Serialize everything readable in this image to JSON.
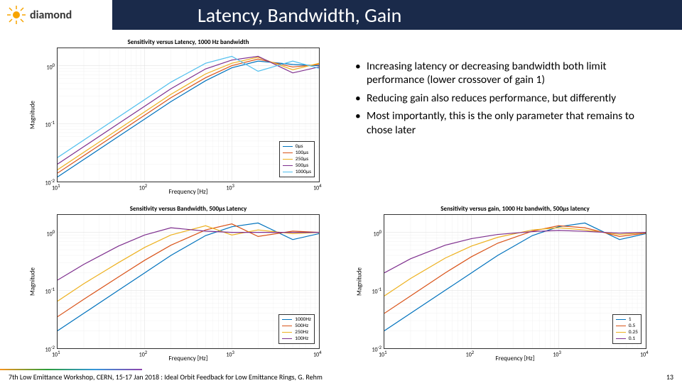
{
  "header": {
    "brand": "diamond",
    "title": "Latency, Bandwidth, Gain"
  },
  "bullets": [
    "Increasing latency or decreasing bandwidth both limit performance (lower crossover of gain 1)",
    "Reducing gain also reduces performance, but differently",
    "Most importantly, this is the only parameter that remains to chose later"
  ],
  "footer": {
    "text": "7th Low Emittance Workshop, CERN, 15-17 Jan 2018 : Ideal Orbit Feedback for Low Emittance Rings, G. Rehm",
    "page": "13"
  },
  "colors": {
    "c1": "#0072BD",
    "c2": "#D95319",
    "c3": "#EDB120",
    "c4": "#7E2F8E",
    "c5": "#4DBEEE"
  },
  "chart_data": [
    {
      "id": "chart-latency",
      "title": "Sensitivity versus Latency, 1000 Hz bandwidth",
      "type": "line",
      "x_scale": "log",
      "y_scale": "log",
      "xlabel": "Frequency [Hz]",
      "ylabel": "Magnitude",
      "xlim": [
        10,
        10000
      ],
      "ylim": [
        0.01,
        2
      ],
      "xticks": [
        10,
        100,
        1000,
        10000
      ],
      "yticks": [
        0.01,
        0.1,
        1
      ],
      "legend_pos": "bottom-right",
      "series": [
        {
          "name": "0µs",
          "color": "c1",
          "x": [
            10,
            20,
            50,
            100,
            200,
            500,
            1000,
            2000,
            5000,
            10000
          ],
          "y": [
            0.012,
            0.024,
            0.06,
            0.12,
            0.24,
            0.55,
            0.92,
            1.2,
            1.05,
            1.0
          ]
        },
        {
          "name": "100µs",
          "color": "c2",
          "x": [
            10,
            20,
            50,
            100,
            200,
            500,
            1000,
            2000,
            5000,
            10000
          ],
          "y": [
            0.014,
            0.028,
            0.07,
            0.14,
            0.28,
            0.62,
            1.0,
            1.3,
            0.95,
            1.05
          ]
        },
        {
          "name": "250µs",
          "color": "c3",
          "x": [
            10,
            20,
            50,
            100,
            200,
            500,
            1000,
            2000,
            5000,
            10000
          ],
          "y": [
            0.016,
            0.032,
            0.08,
            0.16,
            0.32,
            0.72,
            1.1,
            1.4,
            0.85,
            1.1
          ]
        },
        {
          "name": "500µs",
          "color": "c4",
          "x": [
            10,
            20,
            50,
            100,
            200,
            500,
            1000,
            2000,
            5000,
            10000
          ],
          "y": [
            0.02,
            0.04,
            0.1,
            0.2,
            0.4,
            0.88,
            1.25,
            1.45,
            0.75,
            0.95
          ]
        },
        {
          "name": "1000µs",
          "color": "c5",
          "x": [
            10,
            20,
            50,
            100,
            200,
            500,
            1000,
            2000,
            5000,
            10000
          ],
          "y": [
            0.026,
            0.052,
            0.13,
            0.26,
            0.52,
            1.1,
            1.45,
            0.8,
            1.2,
            0.9
          ]
        }
      ]
    },
    {
      "id": "chart-bandwidth",
      "title": "Sensitivity versus Bandwidth, 500µs Latency",
      "type": "line",
      "x_scale": "log",
      "y_scale": "log",
      "xlabel": "Frequency [Hz]",
      "ylabel": "Magnitude",
      "xlim": [
        10,
        10000
      ],
      "ylim": [
        0.01,
        2
      ],
      "xticks": [
        10,
        100,
        1000,
        10000
      ],
      "yticks": [
        0.01,
        0.1,
        1
      ],
      "legend_pos": "bottom-right",
      "series": [
        {
          "name": "1000Hz",
          "color": "c1",
          "x": [
            10,
            20,
            50,
            100,
            200,
            500,
            1000,
            2000,
            5000,
            10000
          ],
          "y": [
            0.02,
            0.04,
            0.1,
            0.2,
            0.4,
            0.88,
            1.25,
            1.45,
            0.75,
            0.95
          ]
        },
        {
          "name": "500Hz",
          "color": "c2",
          "x": [
            10,
            20,
            50,
            100,
            200,
            500,
            1000,
            2000,
            5000,
            10000
          ],
          "y": [
            0.035,
            0.07,
            0.17,
            0.33,
            0.6,
            1.1,
            1.4,
            0.85,
            1.05,
            1.0
          ]
        },
        {
          "name": "250Hz",
          "color": "c3",
          "x": [
            10,
            20,
            50,
            100,
            200,
            500,
            1000,
            2000,
            5000,
            10000
          ],
          "y": [
            0.065,
            0.13,
            0.3,
            0.55,
            0.9,
            1.3,
            0.9,
            1.1,
            0.95,
            1.0
          ]
        },
        {
          "name": "100Hz",
          "color": "c4",
          "x": [
            10,
            20,
            50,
            100,
            200,
            500,
            1000,
            2000,
            5000,
            10000
          ],
          "y": [
            0.15,
            0.28,
            0.58,
            0.9,
            1.2,
            1.05,
            1.0,
            1.0,
            1.0,
            1.0
          ]
        }
      ]
    },
    {
      "id": "chart-gain",
      "title": "Sensitivity versus gain, 1000 Hz bandwith, 500µs latency",
      "type": "line",
      "x_scale": "log",
      "y_scale": "log",
      "xlabel": "Frequency [Hz]",
      "ylabel": "Magnitude",
      "xlim": [
        10,
        10000
      ],
      "ylim": [
        0.01,
        2
      ],
      "xticks": [
        10,
        100,
        1000,
        10000
      ],
      "yticks": [
        0.01,
        0.1,
        1
      ],
      "legend_pos": "bottom-right",
      "series": [
        {
          "name": "1",
          "color": "c1",
          "x": [
            10,
            20,
            50,
            100,
            200,
            500,
            1000,
            2000,
            5000,
            10000
          ],
          "y": [
            0.02,
            0.04,
            0.1,
            0.2,
            0.4,
            0.88,
            1.25,
            1.45,
            0.75,
            0.95
          ]
        },
        {
          "name": "0.5",
          "color": "c2",
          "x": [
            10,
            20,
            50,
            100,
            200,
            500,
            1000,
            2000,
            5000,
            10000
          ],
          "y": [
            0.04,
            0.08,
            0.2,
            0.38,
            0.65,
            1.05,
            1.3,
            1.2,
            0.85,
            0.97
          ]
        },
        {
          "name": "0.25",
          "color": "c3",
          "x": [
            10,
            20,
            50,
            100,
            200,
            500,
            1000,
            2000,
            5000,
            10000
          ],
          "y": [
            0.08,
            0.16,
            0.36,
            0.58,
            0.82,
            1.1,
            1.2,
            1.1,
            0.92,
            0.99
          ]
        },
        {
          "name": "0.1",
          "color": "c4",
          "x": [
            10,
            20,
            50,
            100,
            200,
            500,
            1000,
            2000,
            5000,
            10000
          ],
          "y": [
            0.2,
            0.35,
            0.6,
            0.78,
            0.92,
            1.03,
            1.08,
            1.04,
            0.97,
            1.0
          ]
        }
      ]
    }
  ]
}
